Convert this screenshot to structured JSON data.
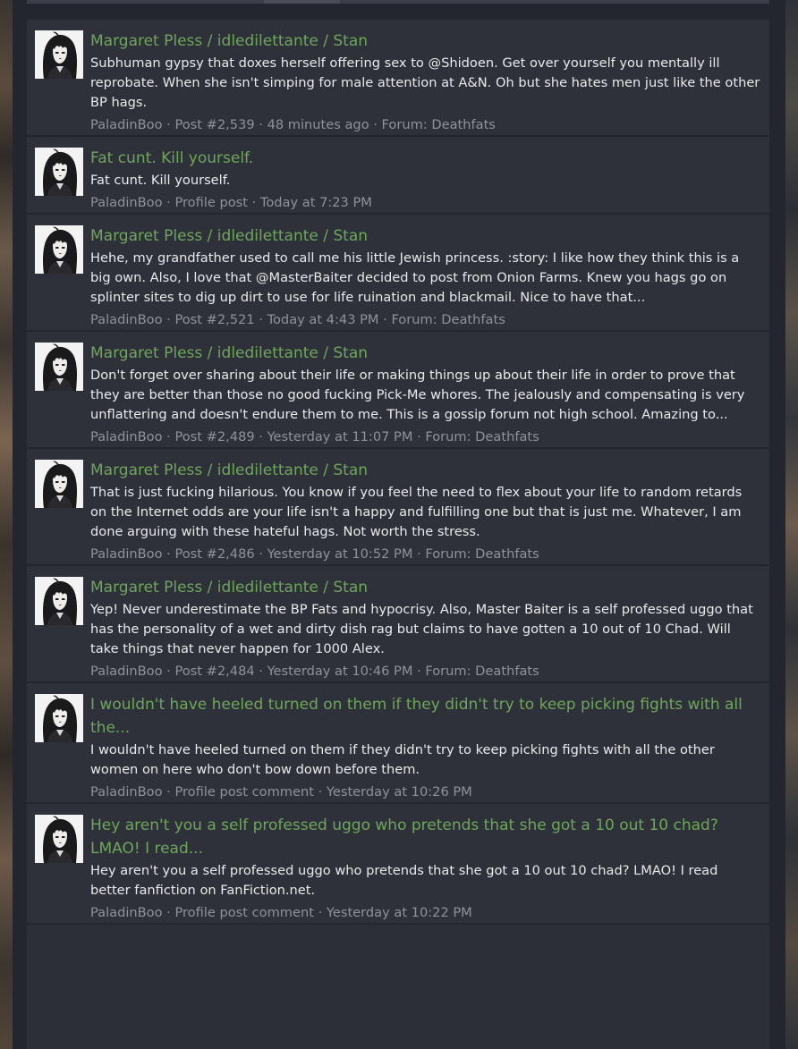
{
  "results": [
    {
      "title": "Margaret Pless / idledilettante / Stan",
      "snippet": "Subhuman gypsy that doxes herself offering sex to @Shidoen. Get over yourself you mentally ill reprobate. When she isn't simping for male attention at A&N. Oh but she hates men just like the other BP hags.",
      "user": "PaladinBoo",
      "detail": "Post #2,539",
      "time": "48 minutes ago",
      "forum": "Forum: Deathfats"
    },
    {
      "title": "Fat cunt. Kill yourself.",
      "snippet": "Fat cunt. Kill yourself.",
      "user": "PaladinBoo",
      "detail": "Profile post",
      "time": "Today at 7:23 PM",
      "forum": ""
    },
    {
      "title": "Margaret Pless / idledilettante / Stan",
      "snippet": "Hehe, my grandfather used to call me his little Jewish princess. :story: I like how they think this is a big own. Also, I love that @MasterBaiter decided to post from Onion Farms. Knew you hags go on splinter sites to dig up dirt to use for life ruination and blackmail. Nice to have that...",
      "user": "PaladinBoo",
      "detail": "Post #2,521",
      "time": "Today at 4:43 PM",
      "forum": "Forum: Deathfats"
    },
    {
      "title": "Margaret Pless / idledilettante / Stan",
      "snippet": "Don't forget over sharing about their life or making things up about their life in order to prove that they are better than those no good fucking Pick-Me whores. The jealously and compensating is very unflattering and doesn't endure them to me. This is a gossip forum not high school. Amazing to...",
      "user": "PaladinBoo",
      "detail": "Post #2,489",
      "time": "Yesterday at 11:07 PM",
      "forum": "Forum: Deathfats"
    },
    {
      "title": "Margaret Pless / idledilettante / Stan",
      "snippet": "That is just fucking hilarious. You know if you feel the need to flex about your life to random retards on the Internet odds are your life isn't a happy and fulfilling one but that is just me. Whatever, I am done arguing with these hateful hags. Not worth the stress.",
      "user": "PaladinBoo",
      "detail": "Post #2,486",
      "time": "Yesterday at 10:52 PM",
      "forum": "Forum: Deathfats"
    },
    {
      "title": "Margaret Pless / idledilettante / Stan",
      "snippet": "Yep! Never underestimate the BP Fats and hypocrisy. Also, Master Baiter is a self professed uggo that has the personality of a wet and dirty dish rag but claims to have gotten a 10 out of 10 Chad. Will take things that never happen for 1000 Alex.",
      "user": "PaladinBoo",
      "detail": "Post #2,484",
      "time": "Yesterday at 10:46 PM",
      "forum": "Forum: Deathfats"
    },
    {
      "title": "I wouldn't have heeled turned on them if they didn't try to keep picking fights with all the...",
      "snippet": "I wouldn't have heeled turned on them if they didn't try to keep picking fights with all the other women on here who don't bow down before them.",
      "user": "PaladinBoo",
      "detail": "Profile post comment",
      "time": "Yesterday at 10:26 PM",
      "forum": ""
    },
    {
      "title": "Hey aren't you a self professed uggo who pretends that she got a 10 out 10 chad? LMAO! I read...",
      "snippet": "Hey aren't you a self professed uggo who pretends that she got a 10 out 10 chad? LMAO! I read better fanfiction on FanFiction.net.",
      "user": "PaladinBoo",
      "detail": "Profile post comment",
      "time": "Yesterday at 10:22 PM",
      "forum": ""
    }
  ],
  "separator": " · ",
  "colors": {
    "title_link": "#6ea65a",
    "snippet_text": "#e9eaec",
    "meta_text": "#8e929a",
    "row_bg": "#2e3139"
  },
  "avatar_icon": "user-avatar-anime-girl-icon"
}
